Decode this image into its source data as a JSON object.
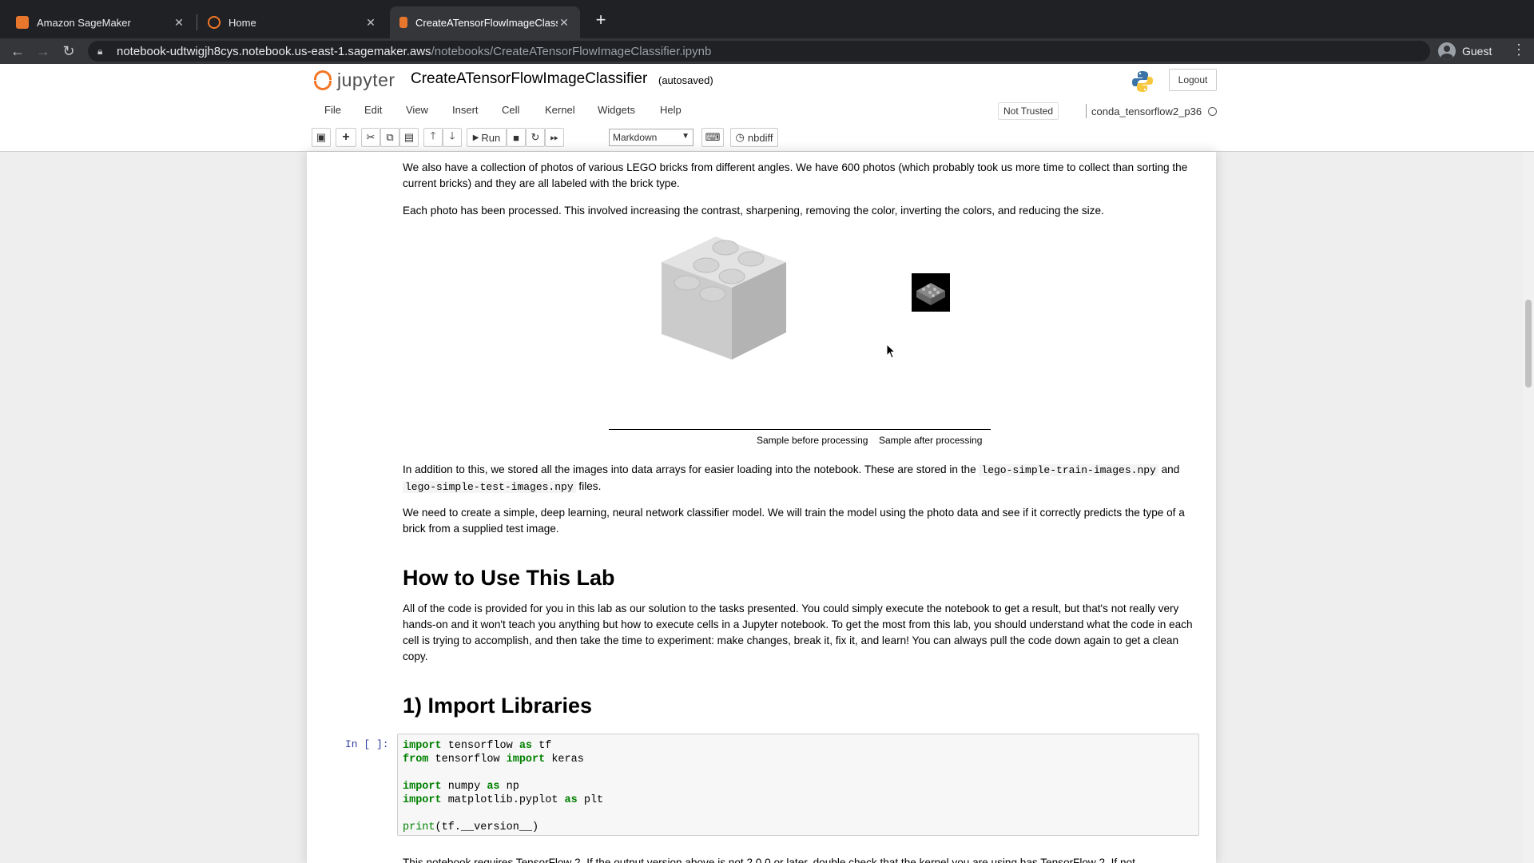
{
  "browser": {
    "tabs": [
      {
        "title": "Amazon SageMaker",
        "active": false
      },
      {
        "title": "Home",
        "active": false
      },
      {
        "title": "CreateATensorFlowImageClassifier.ipynb",
        "active": true
      }
    ],
    "url_host": "notebook-udtwigjh8cys.notebook.us-east-1.sagemaker.aws",
    "url_path": "/notebooks/CreateATensorFlowImageClassifier.ipynb",
    "profile_label": "Guest"
  },
  "jupyter": {
    "logo_text": "jupyter",
    "notebook_name": "CreateATensorFlowImageClassifier",
    "save_status": "(autosaved)",
    "logout_label": "Logout",
    "menu": [
      "File",
      "Edit",
      "View",
      "Insert",
      "Cell",
      "Kernel",
      "Widgets",
      "Help"
    ],
    "trust_label": "Not Trusted",
    "kernel_name": "conda_tensorflow2_p36",
    "toolbar": {
      "run_label": "Run",
      "cell_type": "Markdown",
      "nbdiff_label": "nbdiff"
    }
  },
  "content": {
    "p1": "We also have a collection of photos of various LEGO bricks from different angles. We have 600 photos (which probably took us more time to collect than sorting the current bricks) and they are all labeled with the brick type.",
    "p2": "Each photo has been processed. This involved increasing the contrast, sharpening, removing the color, inverting the colors, and reducing the size.",
    "caption_before": "Sample before processing",
    "caption_after": "Sample after processing",
    "p3_a": "In addition to this, we stored all the images into data arrays for easier loading into the notebook. These are stored in the ",
    "p3_code1": "lego-simple-train-images.npy",
    "p3_b": " and ",
    "p3_code2": "lego-simple-test-images.npy",
    "p3_c": " files.",
    "p4": "We need to create a simple, deep learning, neural network classifier model. We will train the model using the photo data and see if it correctly predicts the type of a brick from a supplied test image.",
    "h_how": "How to Use This Lab",
    "p5": "All of the code is provided for you in this lab as our solution to the tasks presented. You could simply execute the notebook to get a result, but that's not really very hands-on and it won't teach you anything but how to execute cells in a Jupyter notebook. To get the most from this lab, you should understand what the code in each cell is trying to accomplish, and then take the time to experiment: make changes, break it, fix it, and learn! You can always pull the code down again to get a clean copy.",
    "h_import": "1) Import Libraries",
    "prompt": "In [ ]:",
    "code_lines": [
      [
        "import",
        " tensorflow ",
        "as",
        " tf"
      ],
      [
        "from",
        " tensorflow ",
        "import",
        " keras"
      ],
      [],
      [
        "import",
        " numpy ",
        "as",
        " np"
      ],
      [
        "import",
        " matplotlib.pyplot ",
        "as",
        " plt"
      ],
      [],
      [
        "print",
        "(tf.__version__)"
      ]
    ],
    "p6_partial": "This notebook requires TensorFlow 2. If the output version above is not 2.0.0 or later, double check that the kernel you are using has TensorFlow 2. If not"
  },
  "colors": {
    "jupyter_orange": "#f37726",
    "keyword_green": "#008000",
    "prompt_blue": "#303f9f"
  }
}
